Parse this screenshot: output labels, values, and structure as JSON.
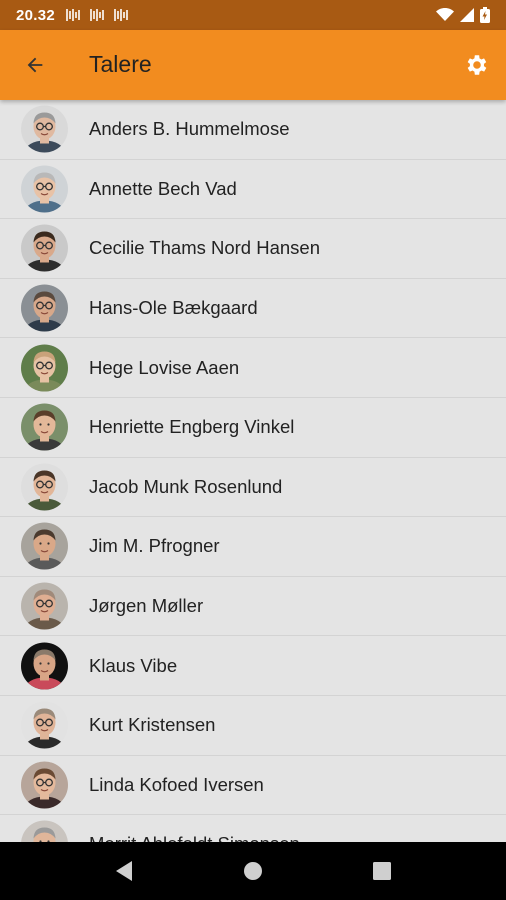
{
  "status_bar": {
    "time": "20.32",
    "notification_icons": [
      "notification-icon",
      "notification-icon",
      "notification-icon"
    ],
    "wifi_icon": "wifi-icon",
    "signal_icon": "signal-icon",
    "battery_icon": "battery-charging-icon"
  },
  "app_bar": {
    "title": "Talere",
    "back_icon": "arrow-back-icon",
    "settings_icon": "gear-icon",
    "background_color": "#f28c1f"
  },
  "speakers": [
    {
      "name": "Anders B. Hummelmose",
      "avatar_bg": "#d9d9d9",
      "skin": "#e0b9a0",
      "hair": "#9a9a9a",
      "shirt": "#3c4a5a",
      "glasses": true
    },
    {
      "name": "Annette Bech Vad",
      "avatar_bg": "#cfd3d6",
      "skin": "#e8c2a6",
      "hair": "#b8b8b8",
      "shirt": "#4f6f8a",
      "glasses": true
    },
    {
      "name": "Cecilie Thams Nord Hansen",
      "avatar_bg": "#c9c9c9",
      "skin": "#d9a98b",
      "hair": "#3a2a1e",
      "shirt": "#2d2d2d",
      "glasses": true
    },
    {
      "name": "Hans-Ole Bækgaard",
      "avatar_bg": "#8a8f94",
      "skin": "#d7a88a",
      "hair": "#5a4a3e",
      "shirt": "#2e3b4a",
      "glasses": true
    },
    {
      "name": "Hege Lovise Aaen",
      "avatar_bg": "#5f7d4a",
      "skin": "#e6c2a4",
      "hair": "#c9a27a",
      "shirt": "#7a8a5a",
      "glasses": true
    },
    {
      "name": "Henriette Engberg Vinkel",
      "avatar_bg": "#7a8f6a",
      "skin": "#e3b899",
      "hair": "#5a3e2a",
      "shirt": "#3a3a3a",
      "glasses": false
    },
    {
      "name": "Jacob Munk Rosenlund",
      "avatar_bg": "#dedede",
      "skin": "#e2b698",
      "hair": "#4a3628",
      "shirt": "#4a5a3a",
      "glasses": true
    },
    {
      "name": "Jim M. Pfrogner",
      "avatar_bg": "#a7a39c",
      "skin": "#d9a888",
      "hair": "#4a3a2e",
      "shirt": "#5a5a5a",
      "glasses": false
    },
    {
      "name": "Jørgen Møller",
      "avatar_bg": "#b9b4ad",
      "skin": "#dfae92",
      "hair": "#a08a7a",
      "shirt": "#6a5a4a",
      "glasses": true
    },
    {
      "name": "Klaus Vibe",
      "avatar_bg": "#111111",
      "skin": "#d8a586",
      "hair": "#8a7a6a",
      "shirt": "#c94a5a",
      "glasses": false
    },
    {
      "name": "Kurt Kristensen",
      "avatar_bg": "#e2e2e2",
      "skin": "#e0b498",
      "hair": "#9a8a7a",
      "shirt": "#2a2a2a",
      "glasses": true
    },
    {
      "name": "Linda Kofoed Iversen",
      "avatar_bg": "#b7a59a",
      "skin": "#e4b99c",
      "hair": "#6a4a34",
      "shirt": "#3a2a2a",
      "glasses": true
    },
    {
      "name": "Merrit Ahlefeldt Simonsen",
      "avatar_bg": "#c9c4bf",
      "skin": "#e0b69a",
      "hair": "#9a9a9a",
      "shirt": "#5a5a5a",
      "glasses": false
    }
  ],
  "nav_bar": {
    "back_icon": "nav-back-icon",
    "home_icon": "nav-home-icon",
    "recents_icon": "nav-recents-icon"
  }
}
